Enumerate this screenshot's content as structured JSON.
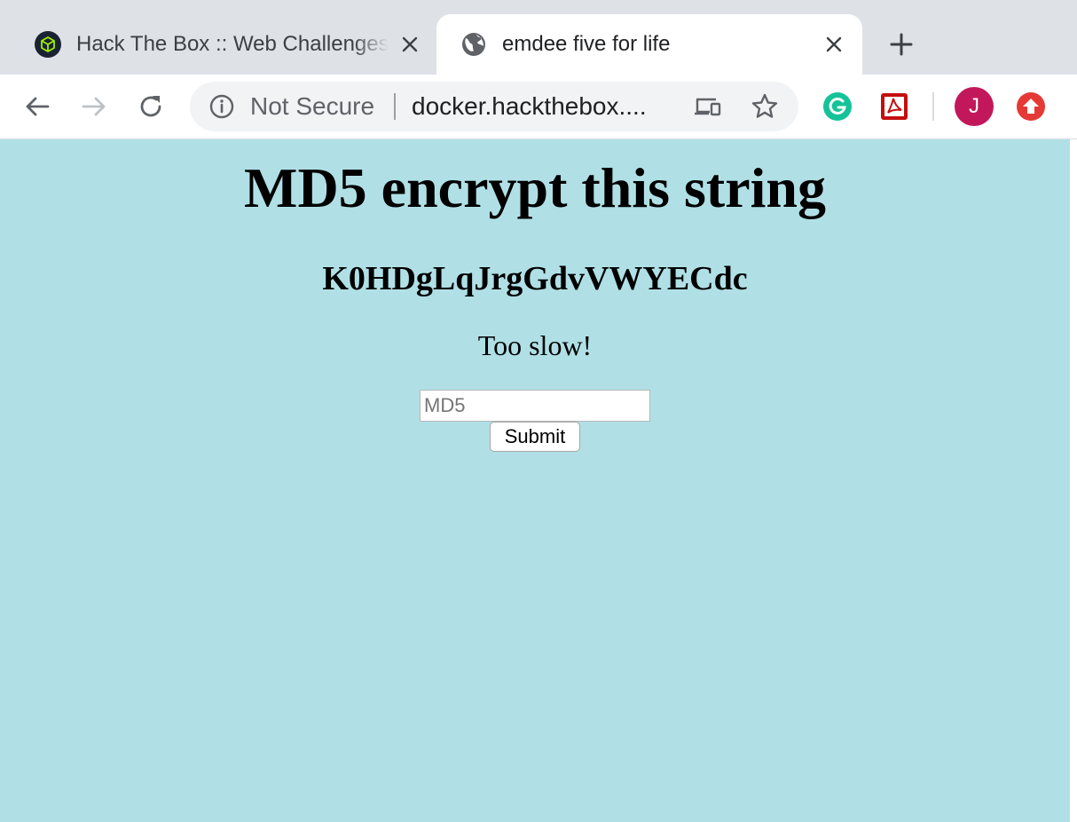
{
  "browser": {
    "tabs": [
      {
        "title": "Hack The Box :: Web Challenges",
        "active": false
      },
      {
        "title": "emdee five for life",
        "active": true
      }
    ],
    "omnibox": {
      "security_label": "Not Secure",
      "url": "docker.hackthebox...."
    },
    "profile": {
      "initial": "J",
      "color": "#c2185b"
    }
  },
  "page": {
    "background_color": "#b0e0e6",
    "heading": "MD5 encrypt this string",
    "challenge_string": "K0HDgLqJrgGdvVWYECdc",
    "status": "Too slow!",
    "form": {
      "input_placeholder": "MD5",
      "input_value": "",
      "submit_label": "Submit"
    }
  }
}
